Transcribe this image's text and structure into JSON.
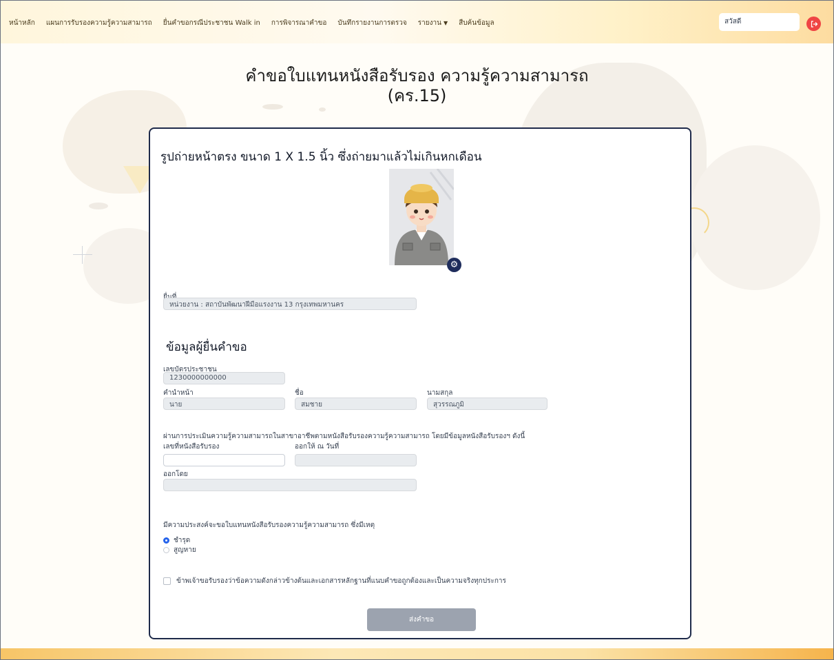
{
  "nav": {
    "items": [
      {
        "label": "หน้าหลัก"
      },
      {
        "label": "แผนการรับรองความรู้ความสามารถ"
      },
      {
        "label": "ยื่นคำขอกรณีประชาชน Walk in"
      },
      {
        "label": "การพิจารณาคำขอ"
      },
      {
        "label": "บันทึกรายงานการตรวจ"
      },
      {
        "label": "รายงาน"
      },
      {
        "label": "สืบค้นข้อมูล"
      }
    ],
    "user_greeting": "สวัสดี"
  },
  "page": {
    "title_line1": "คำขอใบแทนหนังสือรับรอง ความรู้ความสามารถ",
    "title_line2": "(คร.15)"
  },
  "form": {
    "photo_heading": "รูปถ่ายหน้าตรง ขนาด 1 X 1.5 นิ้ว ซึ่งถ่ายมาแล้วไม่เกินหกเดือน",
    "submit_at_label": "ยื่นที่",
    "submit_at_value": "หน่วยงาน : สถาบันพัฒนาฝีมือแรงงาน 13 กรุงเทพมหานคร",
    "applicant_heading": "ข้อมูลผู้ยื่นคำขอ",
    "id_card_label": "เลขบัตรประชาชน",
    "id_card_value": "1230000000000",
    "prefix_label": "คำนำหน้า",
    "prefix_value": "นาย",
    "firstname_label": "ชื่อ",
    "firstname_value": "สมชาย",
    "lastname_label": "นามสกุล",
    "lastname_value": "สุวรรณภูมิ",
    "assessment_text": "ผ่านการประเมินความรู้ความสามารถในสาขาอาชีพตามหนังสือรับรองความรู้ความสามารถ โดยมีข้อมูลหนังสือรับรองฯ ดังนี้",
    "cert_no_label": "เลขที่หนังสือรับรอง",
    "cert_no_value": "",
    "issue_date_label": "ออกให้ ณ วันที่",
    "issue_date_value": "",
    "issued_by_label": "ออกโดย",
    "issued_by_value": "",
    "reason_label": "มีความประสงค์จะขอใบแทนหนังสือรับรองความรู้ความสามารถ ซึ่งมีเหตุ",
    "reason_options": [
      {
        "label": "ชำรุด",
        "selected": true
      },
      {
        "label": "สูญหาย",
        "selected": false
      }
    ],
    "certify_text": "ข้าพเจ้าขอรับรองว่าข้อความดังกล่าวข้างต้นและเอกสารหลักฐานที่แนบคำขอถูกต้องและเป็นความจริงทุกประการ",
    "certify_checked": false,
    "submit_label": "ส่งคำขอ"
  },
  "colors": {
    "card_border": "#1e2a4a",
    "radio_selected": "#2563eb",
    "submit_disabled": "#9ca3af",
    "logout": "#ef4444"
  },
  "icons": {
    "logout": "logout-icon",
    "photo_settings": "gear-icon",
    "dropdown": "caret-down-icon"
  }
}
